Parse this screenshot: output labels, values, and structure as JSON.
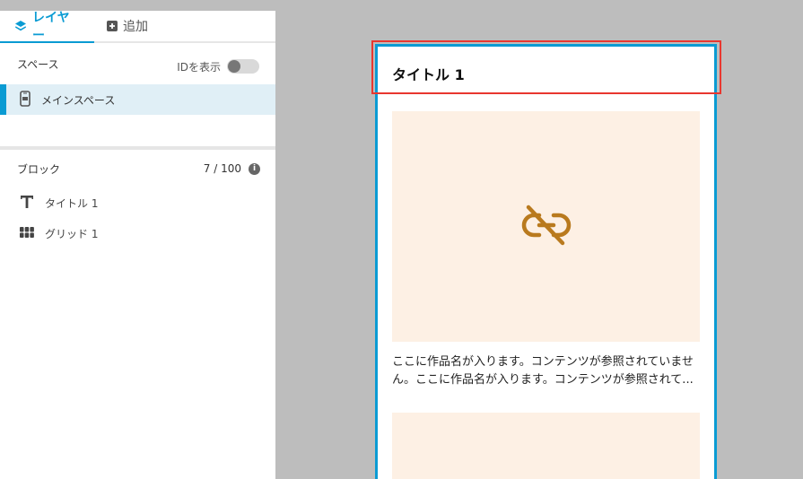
{
  "tabs": [
    {
      "label": "レイヤー",
      "icon": "layers-icon",
      "active": true
    },
    {
      "label": "追加",
      "icon": "add-square-icon",
      "active": false
    }
  ],
  "spaces": {
    "title": "スペース",
    "toggle_label": "IDを表示",
    "toggle_on": false,
    "items": [
      {
        "label": "メインスペース",
        "icon": "phone-icon",
        "selected": true
      }
    ]
  },
  "blocks": {
    "title": "ブロック",
    "count": "7 / 100",
    "items": [
      {
        "label": "タイトル 1",
        "icon": "text-t-icon"
      },
      {
        "label": "グリッド 1",
        "icon": "grid-icon"
      }
    ]
  },
  "preview": {
    "title": "タイトル 1",
    "card_text": "ここに作品名が入ります。コンテンツが参照されていません。ここに作品名が入ります。コンテンツが参照されて...",
    "placeholder_icon": "broken-link-icon"
  },
  "colors": {
    "accent": "#0a9bd3",
    "selection": "#e8372f",
    "placeholder_bg": "#fdf0e4",
    "placeholder_icon": "#b97a1e"
  }
}
